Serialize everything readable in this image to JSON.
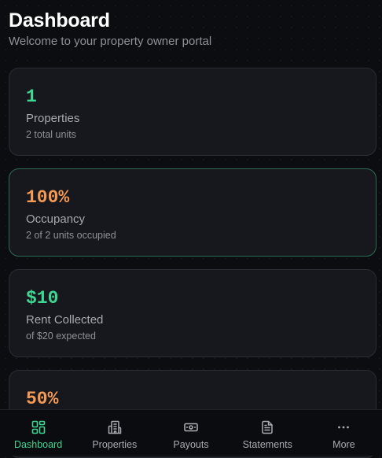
{
  "header": {
    "title": "Dashboard",
    "subtitle": "Welcome to your property owner portal"
  },
  "cards": [
    {
      "value": "1",
      "label": "Properties",
      "sub": "2 total units",
      "value_color": "#3fd592"
    },
    {
      "value": "100%",
      "label": "Occupancy",
      "sub": "2 of 2 units occupied",
      "value_color": "#f49a55"
    },
    {
      "value": "$10",
      "label": "Rent Collected",
      "sub": "of $20 expected",
      "value_color": "#3fd592"
    },
    {
      "value": "50%",
      "label": "",
      "sub": "",
      "value_color": "#f49a55"
    }
  ],
  "nav": {
    "active": "Dashboard",
    "items": [
      {
        "label": "Dashboard",
        "icon": "grid-icon"
      },
      {
        "label": "Properties",
        "icon": "building-icon"
      },
      {
        "label": "Payouts",
        "icon": "banknote-icon"
      },
      {
        "label": "Statements",
        "icon": "document-icon"
      },
      {
        "label": "More",
        "icon": "more-dots-icon"
      }
    ]
  },
  "colors": {
    "background": "#0c0d10",
    "card": "#16181d",
    "card_border": "#2a2d33",
    "active_border": "#2f6b52",
    "accent_green": "#3fd592",
    "accent_orange": "#f49a55",
    "muted_text": "#8e9196"
  }
}
